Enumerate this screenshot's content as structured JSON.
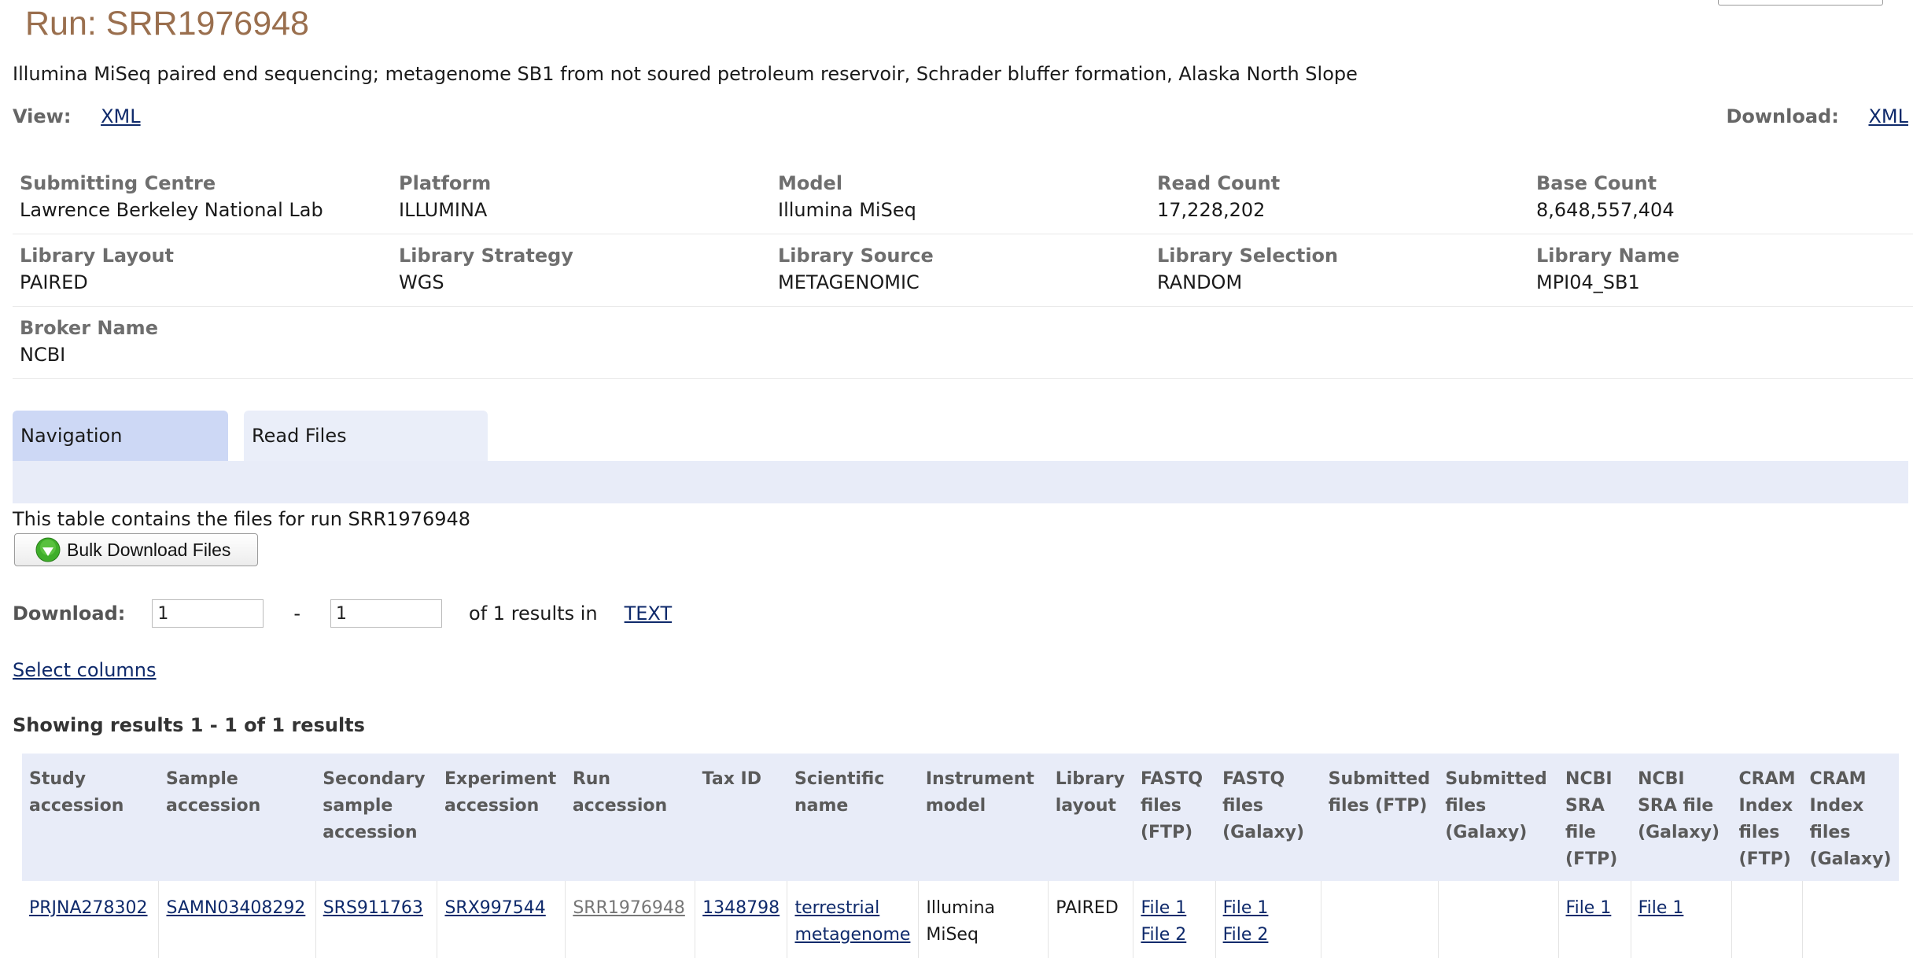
{
  "header": {
    "title": "Run: SRR1976948",
    "description": "Illumina MiSeq paired end sequencing; metagenome SB1 from not soured petroleum reservoir, Schrader bluffer formation, Alaska North Slope"
  },
  "view": {
    "label": "View:",
    "xml": "XML"
  },
  "download_top": {
    "label": "Download:",
    "xml": "XML"
  },
  "meta": [
    [
      {
        "key": "Submitting Centre",
        "value": "Lawrence Berkeley National Lab"
      },
      {
        "key": "Platform",
        "value": "ILLUMINA"
      },
      {
        "key": "Model",
        "value": "Illumina MiSeq"
      },
      {
        "key": "Read Count",
        "value": "17,228,202"
      },
      {
        "key": "Base Count",
        "value": "8,648,557,404"
      }
    ],
    [
      {
        "key": "Library Layout",
        "value": "PAIRED"
      },
      {
        "key": "Library Strategy",
        "value": "WGS"
      },
      {
        "key": "Library Source",
        "value": "METAGENOMIC"
      },
      {
        "key": "Library Selection",
        "value": "RANDOM"
      },
      {
        "key": "Library Name",
        "value": "MPI04_SB1"
      }
    ],
    [
      {
        "key": "Broker Name",
        "value": "NCBI"
      }
    ]
  ],
  "tabs": [
    {
      "label": "Navigation",
      "active": true
    },
    {
      "label": "Read Files",
      "active": false
    }
  ],
  "files": {
    "intro": "This table contains the files for run SRR1976948",
    "bulk_button": "Bulk Download Files",
    "download_label": "Download:",
    "from_value": "1",
    "dash": "-",
    "to_value": "1",
    "results_text": "of 1 results in",
    "format_link": "TEXT",
    "select_columns": "Select columns",
    "showing": "Showing results 1 - 1 of 1 results"
  },
  "table": {
    "headers": [
      "Study accession",
      "Sample accession",
      "Secondary sample accession",
      "Experiment accession",
      "Run accession",
      "Tax ID",
      "Scientific name",
      "Instrument model",
      "Library layout",
      "FASTQ files (FTP)",
      "FASTQ files (Galaxy)",
      "Submitted files (FTP)",
      "Submitted files (Galaxy)",
      "NCBI SRA file (FTP)",
      "NCBI SRA file (Galaxy)",
      "CRAM Index files (FTP)",
      "CRAM Index files (Galaxy)"
    ],
    "row": {
      "study": "PRJNA278302",
      "sample": "SAMN03408292",
      "secondary_sample": "SRS911763",
      "experiment": "SRX997544",
      "run": "SRR1976948",
      "tax_id": "1348798",
      "scientific_name": "terrestrial metagenome",
      "instrument": "Illumina MiSeq",
      "layout": "PAIRED",
      "fastq_ftp": [
        "File 1",
        "File 2"
      ],
      "fastq_galaxy": [
        "File 1",
        "File 2"
      ],
      "sra_ftp": "File 1",
      "sra_galaxy": "File 1"
    }
  }
}
